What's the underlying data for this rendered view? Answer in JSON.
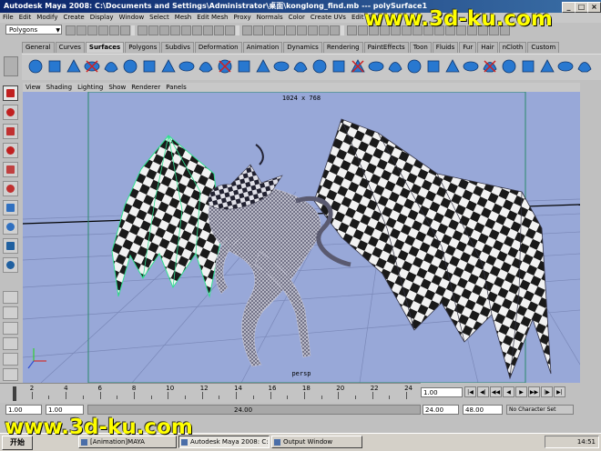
{
  "window": {
    "title": "Autodesk Maya 2008: C:\\Documents and Settings\\Administrator\\桌面\\konglong_find.mb  ---  polySurface1",
    "controls": [
      "_",
      "□",
      "×"
    ]
  },
  "menubar": [
    "File",
    "Edit",
    "Modify",
    "Create",
    "Display",
    "Window",
    "Select",
    "Mesh",
    "Edit Mesh",
    "Proxy",
    "Normals",
    "Color",
    "Create UVs",
    "Edit UVs"
  ],
  "status_line": {
    "menu_set": "Polygons"
  },
  "shelf": {
    "tabs": [
      {
        "label": "General"
      },
      {
        "label": "Curves"
      },
      {
        "label": "Surfaces",
        "active": true
      },
      {
        "label": "Polygons"
      },
      {
        "label": "Subdivs"
      },
      {
        "label": "Deformation"
      },
      {
        "label": "Animation"
      },
      {
        "label": "Dynamics"
      },
      {
        "label": "Rendering"
      },
      {
        "label": "PaintEffects"
      },
      {
        "label": "Toon"
      },
      {
        "label": "Fluids"
      },
      {
        "label": "Fur"
      },
      {
        "label": "Hair"
      },
      {
        "label": "nCloth"
      },
      {
        "label": "Custom"
      }
    ],
    "icons": [
      "nurbs-sphere",
      "nurbs-cube",
      "nurbs-cylinder",
      "nurbs-cone",
      "nurbs-plane",
      "nurbs-torus",
      "nurbs-circle",
      "nurbs-square",
      "revolve",
      "loft",
      "planar",
      "extrude",
      "birail",
      "boundary",
      "square-surface",
      "bevel",
      "bevel-plus",
      "project-curve",
      "intersect",
      "trim",
      "untrim",
      "attach",
      "detach",
      "align",
      "open-close",
      "insert-isoparm",
      "extend",
      "offset",
      "rebuild",
      "reverse"
    ],
    "accent_color": "#2878d0"
  },
  "panel_menu": [
    "View",
    "Shading",
    "Lighting",
    "Show",
    "Renderer",
    "Panels"
  ],
  "viewport": {
    "resolution_gate": "1024 x 768",
    "camera": "persp",
    "background": "#98a8d8"
  },
  "toolbox_tools": [
    "select-tool",
    "lasso-tool",
    "paint-select-tool",
    "move-tool",
    "rotate-tool",
    "scale-tool",
    "universal-manipulator",
    "soft-mod-tool",
    "show-manipulator",
    "last-tool"
  ],
  "time_slider": {
    "labels": [
      "2",
      "4",
      "6",
      "8",
      "10",
      "12",
      "14",
      "16",
      "18",
      "20",
      "22",
      "24"
    ],
    "current_time": "1.00"
  },
  "playback_controls": [
    "|◀",
    "◀|",
    "◀◀",
    "◀",
    "▶",
    "▶▶",
    "|▶",
    "▶|"
  ],
  "range_slider": {
    "start_time": "1.00",
    "playback_start": "1.00",
    "range_label": "24.00",
    "playback_end": "24.00",
    "end_time": "48.00",
    "character_set": "No Character Set"
  },
  "taskbar": {
    "start": "开始",
    "tasks": [
      {
        "label": "[Animation]MAYA"
      },
      {
        "label": "Autodesk Maya 2008: C:...",
        "active": true
      },
      {
        "label": "Output Window"
      }
    ],
    "clock": "14:51"
  },
  "watermarks": [
    "www.3d-ku.com",
    "www.3d-ku.com"
  ]
}
